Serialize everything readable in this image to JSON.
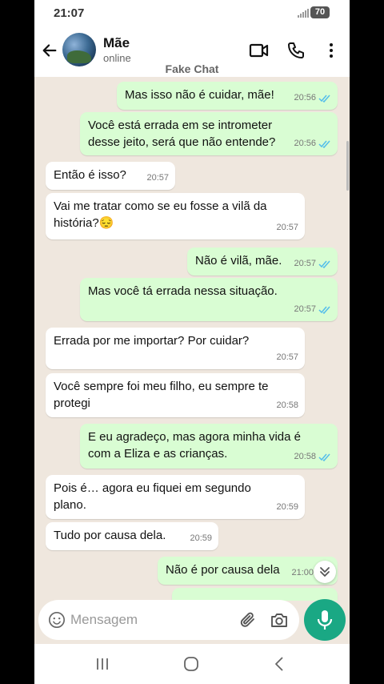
{
  "status_bar": {
    "time": "21:07",
    "battery": "70"
  },
  "header": {
    "name": "Mãe",
    "status": "online",
    "watermark": "Fake Chat"
  },
  "composer": {
    "placeholder": "Mensagem"
  },
  "colors": {
    "incoming_bubble": "#ffffff",
    "outgoing_bubble": "#d9fdd3",
    "chat_bg": "#efe7de",
    "accent": "#1aa884",
    "read_ticks": "#53bdeb"
  },
  "icons": {
    "back": "arrow-left-icon",
    "video": "video-camera-icon",
    "call": "phone-icon",
    "menu": "more-vertical-icon",
    "emoji": "emoji-icon",
    "attach": "paperclip-icon",
    "camera": "camera-icon",
    "mic": "microphone-icon",
    "scroll": "chevron-down-double-icon"
  },
  "messages": [
    {
      "dir": "out",
      "text": "Mas isso não é cuidar, mãe!",
      "time": "20:56",
      "read": true
    },
    {
      "dir": "out",
      "text": "Você está errada em se intrometer desse jeito, será que não entende?",
      "time": "20:56",
      "read": true
    },
    {
      "dir": "in",
      "text": "Então é isso?",
      "time": "20:57"
    },
    {
      "dir": "in",
      "text": "Vai me tratar como se eu fosse a vilã da história?😔",
      "time": "20:57"
    },
    {
      "dir": "out",
      "text": "Não é vilã, mãe.",
      "time": "20:57",
      "read": true
    },
    {
      "dir": "out",
      "text": "Mas você tá errada nessa situação.",
      "time": "20:57",
      "read": true
    },
    {
      "dir": "in",
      "text": "Errada por me importar? Por cuidar?",
      "time": "20:57"
    },
    {
      "dir": "in",
      "text": "Você sempre foi meu filho, eu sempre te protegi",
      "time": "20:58"
    },
    {
      "dir": "out",
      "text": "E eu agradeço, mas agora minha vida é com a Eliza e as crianças.",
      "time": "20:58",
      "read": true
    },
    {
      "dir": "in",
      "text": "Pois é… agora eu fiquei em segundo plano.",
      "time": "20:59"
    },
    {
      "dir": "in",
      "text": "Tudo por causa dela.",
      "time": "20:59"
    },
    {
      "dir": "out",
      "text": "Não é por causa dela",
      "time": "21:00",
      "read": true
    }
  ]
}
